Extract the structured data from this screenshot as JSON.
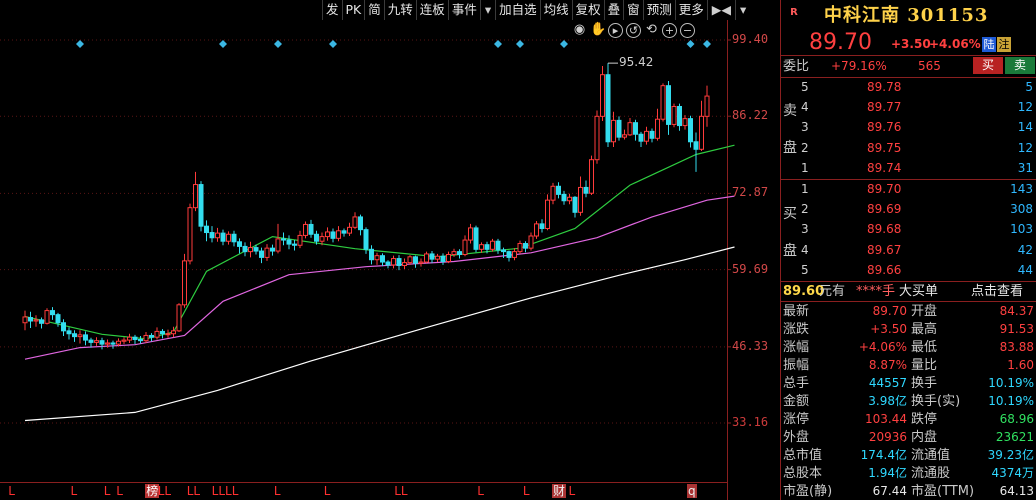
{
  "toolbar": {
    "items": [
      "发",
      "PK",
      "简",
      "九转",
      "连板",
      "事件",
      "▾",
      "加自选",
      "均线",
      "复权",
      "叠",
      "窗",
      "预测",
      "更多",
      "▶◀",
      "▾"
    ]
  },
  "chart_data": {
    "type": "candlestick",
    "y_ticks": [
      "99.40",
      "86.22",
      "72.87",
      "59.69",
      "46.33",
      "33.16"
    ],
    "ylim": [
      29.5,
      103.0
    ],
    "max_marker": "95.42",
    "grid": true,
    "colors": {
      "up": "#ff3b3b",
      "down": "#33ddee",
      "ma_short": "#2ecc40",
      "ma_mid": "#e066e0",
      "ma_long": "#ffffff",
      "grid": "#5a1515"
    },
    "candles": [
      [
        50.5,
        51.5,
        49.2,
        52.6
      ],
      [
        51.4,
        50.8,
        49.6,
        52.4
      ],
      [
        50.8,
        51.0,
        49.8,
        51.8
      ],
      [
        51.0,
        50.4,
        49.5,
        51.4
      ],
      [
        50.4,
        52.6,
        50.2,
        53.0
      ],
      [
        52.6,
        51.9,
        51.0,
        53.2
      ],
      [
        51.9,
        50.5,
        49.8,
        52.2
      ],
      [
        50.5,
        49.1,
        48.2,
        51.1
      ],
      [
        49.1,
        48.6,
        47.6,
        49.7
      ],
      [
        48.6,
        48.1,
        47.2,
        49.2
      ],
      [
        48.1,
        48.4,
        46.9,
        49.2
      ],
      [
        48.4,
        47.5,
        46.6,
        49.0
      ],
      [
        47.5,
        47.1,
        46.2,
        47.9
      ],
      [
        47.1,
        47.4,
        46.5,
        48.0
      ],
      [
        47.4,
        46.8,
        45.9,
        47.9
      ],
      [
        46.8,
        47.0,
        46.2,
        47.6
      ],
      [
        47.0,
        46.8,
        46.0,
        47.4
      ],
      [
        46.8,
        47.3,
        46.4,
        47.8
      ],
      [
        47.3,
        47.5,
        46.8,
        48.0
      ],
      [
        47.5,
        48.0,
        47.0,
        48.6
      ],
      [
        48.0,
        47.6,
        46.8,
        48.4
      ],
      [
        47.6,
        47.4,
        46.9,
        48.2
      ],
      [
        47.4,
        48.3,
        47.0,
        48.9
      ],
      [
        48.3,
        48.0,
        47.3,
        48.7
      ],
      [
        48.0,
        49.0,
        47.6,
        49.7
      ],
      [
        49.0,
        48.6,
        47.8,
        49.4
      ],
      [
        48.6,
        48.6,
        47.9,
        49.3
      ],
      [
        48.6,
        49.1,
        48.0,
        49.8
      ],
      [
        49.1,
        53.6,
        48.9,
        53.9
      ],
      [
        53.6,
        61.2,
        53.1,
        62.4
      ],
      [
        61.2,
        70.4,
        60.6,
        71.1
      ],
      [
        70.4,
        74.4,
        69.8,
        76.6
      ],
      [
        74.4,
        67.2,
        66.3,
        75.0
      ],
      [
        67.2,
        66.1,
        64.6,
        68.2
      ],
      [
        66.1,
        65.2,
        64.4,
        67.2
      ],
      [
        65.2,
        66.0,
        64.5,
        66.9
      ],
      [
        66.0,
        64.6,
        63.9,
        66.6
      ],
      [
        64.6,
        65.8,
        64.0,
        66.3
      ],
      [
        65.8,
        64.5,
        63.7,
        66.4
      ],
      [
        64.5,
        63.7,
        62.5,
        65.1
      ],
      [
        63.7,
        62.8,
        62.0,
        64.4
      ],
      [
        62.8,
        63.5,
        61.8,
        64.5
      ],
      [
        63.5,
        62.9,
        62.3,
        64.0
      ],
      [
        62.9,
        61.8,
        60.8,
        63.5
      ],
      [
        61.8,
        63.4,
        61.2,
        64.1
      ],
      [
        63.4,
        62.9,
        62.1,
        64.0
      ],
      [
        62.9,
        65.0,
        62.5,
        67.6
      ],
      [
        65.0,
        64.8,
        63.9,
        66.1
      ],
      [
        64.8,
        64.1,
        63.2,
        65.6
      ],
      [
        64.1,
        63.9,
        63.0,
        64.8
      ],
      [
        63.9,
        65.6,
        63.4,
        66.4
      ],
      [
        65.6,
        67.5,
        65.1,
        68.0
      ],
      [
        67.5,
        65.8,
        65.2,
        68.3
      ],
      [
        65.8,
        64.6,
        64.0,
        66.4
      ],
      [
        64.6,
        65.4,
        63.9,
        66.1
      ],
      [
        65.4,
        66.2,
        64.7,
        67.0
      ],
      [
        66.2,
        65.1,
        64.4,
        66.8
      ],
      [
        65.1,
        66.4,
        64.6,
        67.2
      ],
      [
        66.4,
        66.0,
        65.4,
        66.8
      ],
      [
        66.0,
        67.0,
        65.5,
        67.8
      ],
      [
        67.0,
        68.8,
        66.7,
        69.6
      ],
      [
        68.8,
        66.6,
        65.6,
        69.2
      ],
      [
        66.6,
        63.2,
        62.4,
        67.0
      ],
      [
        63.2,
        61.4,
        60.6,
        63.9
      ],
      [
        61.4,
        62.1,
        60.5,
        62.6
      ],
      [
        62.1,
        61.0,
        60.3,
        62.5
      ],
      [
        61.0,
        60.5,
        59.9,
        61.3
      ],
      [
        60.5,
        61.6,
        59.9,
        62.1
      ],
      [
        61.6,
        60.4,
        59.6,
        62.2
      ],
      [
        60.4,
        60.9,
        59.8,
        61.6
      ],
      [
        60.9,
        61.9,
        60.5,
        62.2
      ],
      [
        61.9,
        60.8,
        60.0,
        62.1
      ],
      [
        60.8,
        61.0,
        60.2,
        61.6
      ],
      [
        61.0,
        62.4,
        60.8,
        62.8
      ],
      [
        62.4,
        61.5,
        60.8,
        62.9
      ],
      [
        61.5,
        62.0,
        61.0,
        62.4
      ],
      [
        62.0,
        61.1,
        60.5,
        62.5
      ],
      [
        61.1,
        62.3,
        60.8,
        62.8
      ],
      [
        62.3,
        62.8,
        61.9,
        63.3
      ],
      [
        62.8,
        62.3,
        61.6,
        63.2
      ],
      [
        62.3,
        64.8,
        62.0,
        65.6
      ],
      [
        64.8,
        66.9,
        64.2,
        67.6
      ],
      [
        66.9,
        63.2,
        62.7,
        67.3
      ],
      [
        63.2,
        64.0,
        62.6,
        64.4
      ],
      [
        64.0,
        63.2,
        62.5,
        64.5
      ],
      [
        63.2,
        64.6,
        62.8,
        65.0
      ],
      [
        64.6,
        63.1,
        62.4,
        65.0
      ],
      [
        63.1,
        62.8,
        61.7,
        63.5
      ],
      [
        62.8,
        61.8,
        61.1,
        63.0
      ],
      [
        61.8,
        62.8,
        61.3,
        63.4
      ],
      [
        62.8,
        64.2,
        62.4,
        64.7
      ],
      [
        64.2,
        63.4,
        62.7,
        64.6
      ],
      [
        63.4,
        65.5,
        63.0,
        66.1
      ],
      [
        65.5,
        67.6,
        65.0,
        68.1
      ],
      [
        67.6,
        66.8,
        66.1,
        68.4
      ],
      [
        66.8,
        71.7,
        66.5,
        72.7
      ],
      [
        71.7,
        74.1,
        71.0,
        74.7
      ],
      [
        74.1,
        72.7,
        72.0,
        74.8
      ],
      [
        72.7,
        71.6,
        70.9,
        73.3
      ],
      [
        71.6,
        72.2,
        71.0,
        72.8
      ],
      [
        72.2,
        69.6,
        68.7,
        72.4
      ],
      [
        69.6,
        73.9,
        69.0,
        75.8
      ],
      [
        73.9,
        72.9,
        72.2,
        75.1
      ],
      [
        72.9,
        78.7,
        72.6,
        79.4
      ],
      [
        78.7,
        86.2,
        78.0,
        87.2
      ],
      [
        86.2,
        93.4,
        85.4,
        94.9
      ],
      [
        93.4,
        81.8,
        80.9,
        95.4
      ],
      [
        81.8,
        85.5,
        80.9,
        87.0
      ],
      [
        85.5,
        82.6,
        82.0,
        86.2
      ],
      [
        82.6,
        83.0,
        82.2,
        83.9
      ],
      [
        83.0,
        85.1,
        82.8,
        85.9
      ],
      [
        85.1,
        83.1,
        82.0,
        85.6
      ],
      [
        83.1,
        81.9,
        80.9,
        83.5
      ],
      [
        81.9,
        83.6,
        81.3,
        84.4
      ],
      [
        83.6,
        82.4,
        81.7,
        84.1
      ],
      [
        82.4,
        85.7,
        82.0,
        87.5
      ],
      [
        85.7,
        91.5,
        85.3,
        91.9
      ],
      [
        91.5,
        84.8,
        83.0,
        92.3
      ],
      [
        84.8,
        87.9,
        84.3,
        88.4
      ],
      [
        87.9,
        84.6,
        83.7,
        88.4
      ],
      [
        84.6,
        85.8,
        83.9,
        86.4
      ],
      [
        85.8,
        81.8,
        80.8,
        86.3
      ],
      [
        81.8,
        80.5,
        76.6,
        83.4
      ],
      [
        80.5,
        86.2,
        80.2,
        88.9
      ],
      [
        86.2,
        89.7,
        84.4,
        91.5
      ]
    ],
    "ma_short": [
      [
        0,
        51.6
      ],
      [
        14,
        48.5
      ],
      [
        22,
        47.7
      ],
      [
        27,
        48.9
      ],
      [
        33,
        59.4
      ],
      [
        45,
        65.4
      ],
      [
        60,
        63.3
      ],
      [
        75,
        61.9
      ],
      [
        90,
        63.4
      ],
      [
        100,
        66.8
      ],
      [
        110,
        74.3
      ],
      [
        122,
        79.6
      ],
      [
        129,
        81.2
      ]
    ],
    "ma_mid": [
      [
        0,
        44.2
      ],
      [
        10,
        46.2
      ],
      [
        20,
        46.7
      ],
      [
        29,
        48.3
      ],
      [
        36,
        54.2
      ],
      [
        48,
        58.8
      ],
      [
        62,
        60.2
      ],
      [
        78,
        61.1
      ],
      [
        92,
        62.6
      ],
      [
        104,
        65.2
      ],
      [
        114,
        68.8
      ],
      [
        124,
        71.7
      ],
      [
        129,
        72.4
      ]
    ],
    "ma_long": [
      [
        0,
        33.6
      ],
      [
        20,
        35.0
      ],
      [
        35,
        38.8
      ],
      [
        52,
        43.9
      ],
      [
        72,
        49.4
      ],
      [
        92,
        54.8
      ],
      [
        108,
        58.7
      ],
      [
        120,
        61.4
      ],
      [
        129,
        63.6
      ]
    ],
    "event_diamonds": [
      10,
      36,
      46,
      56,
      86,
      126,
      134,
      157,
      160
    ],
    "bottom_labels": [
      {
        "text": "L",
        "idx": 2,
        "style": "red"
      },
      {
        "text": "L",
        "idx": 17,
        "style": "red"
      },
      {
        "text": "L",
        "idx": 25,
        "style": "red"
      },
      {
        "text": "L",
        "idx": 28,
        "style": "red"
      },
      {
        "text": "榜",
        "idx": 35,
        "style": "boxed"
      },
      {
        "text": "LL",
        "idx": 38,
        "style": "red"
      },
      {
        "text": "LL",
        "idx": 45,
        "style": "red"
      },
      {
        "text": "LLLL",
        "idx": 51,
        "style": "red"
      },
      {
        "text": "L",
        "idx": 66,
        "style": "red"
      },
      {
        "text": "L",
        "idx": 78,
        "style": "red"
      },
      {
        "text": "LL",
        "idx": 95,
        "style": "red"
      },
      {
        "text": "L",
        "idx": 115,
        "style": "red"
      },
      {
        "text": "L",
        "idx": 126,
        "style": "red"
      },
      {
        "text": "财",
        "idx": 133,
        "style": "boxed2"
      },
      {
        "text": "L",
        "idx": 137,
        "style": "red"
      },
      {
        "text": "q",
        "idx": 167,
        "style": "boxed2"
      }
    ]
  },
  "panel": {
    "r_tag": "R",
    "stock_name": "中科江南 301153",
    "price": "89.70",
    "change": "+3.50",
    "change_pct": "+4.06%",
    "tag_lu": "陆",
    "tag_zhu": "注",
    "weibi_label": "委比",
    "weibi_value": "+79.16%",
    "weicha": "565",
    "buy_btn": "买",
    "sell_btn": "卖",
    "sell_side_label": [
      "卖",
      "盘"
    ],
    "buy_side_label": [
      "买",
      "盘"
    ],
    "asks": [
      {
        "lvl": "5",
        "px": "89.78",
        "vol": "5"
      },
      {
        "lvl": "4",
        "px": "89.77",
        "vol": "12"
      },
      {
        "lvl": "3",
        "px": "89.76",
        "vol": "14"
      },
      {
        "lvl": "2",
        "px": "89.75",
        "vol": "12"
      },
      {
        "lvl": "1",
        "px": "89.74",
        "vol": "31"
      }
    ],
    "bids": [
      {
        "lvl": "1",
        "px": "89.70",
        "vol": "143"
      },
      {
        "lvl": "2",
        "px": "89.69",
        "vol": "308"
      },
      {
        "lvl": "3",
        "px": "89.68",
        "vol": "103"
      },
      {
        "lvl": "4",
        "px": "89.67",
        "vol": "42"
      },
      {
        "lvl": "5",
        "px": "89.66",
        "vol": "44"
      }
    ],
    "extra": {
      "price": "89.60",
      "unit": "元有",
      "hidden": "****手",
      "label": "大买单",
      "action": "点击查看"
    },
    "stats": [
      {
        "l1": "最新",
        "v1": "89.70",
        "c1": "red",
        "l2": "开盘",
        "v2": "84.37",
        "c2": "red"
      },
      {
        "l1": "涨跌",
        "v1": "+3.50",
        "c1": "red",
        "l2": "最高",
        "v2": "91.53",
        "c2": "red"
      },
      {
        "l1": "涨幅",
        "v1": "+4.06%",
        "c1": "red",
        "l2": "最低",
        "v2": "83.88",
        "c2": "red"
      },
      {
        "l1": "振幅",
        "v1": "8.87%",
        "c1": "red",
        "l2": "量比",
        "v2": "1.60",
        "c2": "red"
      },
      {
        "l1": "总手",
        "v1": "44557",
        "c1": "cyan",
        "l2": "换手",
        "v2": "10.19%",
        "c2": "cyan"
      },
      {
        "l1": "金额",
        "v1": "3.98亿",
        "c1": "cyan",
        "l2": "换手(实)",
        "v2": "10.19%",
        "c2": "cyan"
      },
      {
        "l1": "涨停",
        "v1": "103.44",
        "c1": "red",
        "l2": "跌停",
        "v2": "68.96",
        "c2": "green"
      },
      {
        "l1": "外盘",
        "v1": "20936",
        "c1": "red",
        "l2": "内盘",
        "v2": "23621",
        "c2": "green"
      },
      {
        "l1": "总市值",
        "v1": "174.4亿",
        "c1": "cyan",
        "l2": "流通值",
        "v2": "39.23亿",
        "c2": "cyan"
      },
      {
        "l1": "总股本",
        "v1": "1.94亿",
        "c1": "cyan",
        "l2": "流通股",
        "v2": "4374万",
        "c2": "cyan"
      },
      {
        "l1": "市盈(静)",
        "v1": "67.44",
        "c1": "white",
        "l2": "市盈(TTM)",
        "v2": "64.13",
        "c2": "white"
      }
    ]
  }
}
